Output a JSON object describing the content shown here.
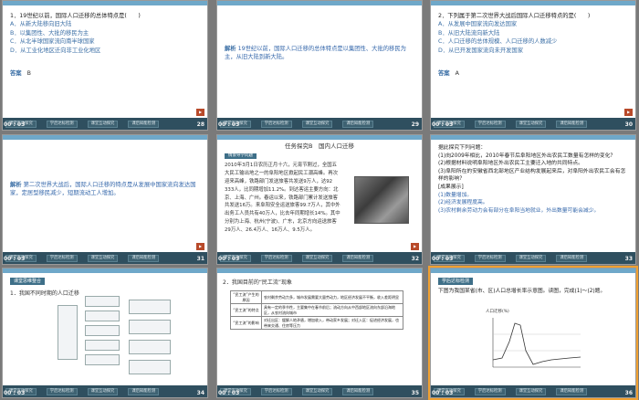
{
  "slides": [
    {
      "page": "28",
      "time": "00 : 03",
      "question": "1．19世纪以前，国际人口迁移的总体特点是(　　)",
      "options": [
        "A．从新大陆移向旧大陆",
        "B．以集团性、大批的移民为主",
        "C．从北半球国家流向南半球国家",
        "D．从工业化地区迁向非工业化地区"
      ],
      "answer_label": "答案",
      "answer": "B"
    },
    {
      "page": "29",
      "time": "00 : 03",
      "analysis_label": "解析",
      "analysis": "19世纪以前，国际人口迁移的总体特点是以集团性、大批的移民为主，从旧大陆到新大陆。"
    },
    {
      "page": "30",
      "time": "00 : 03",
      "question": "2．下列属于第二次世界大战后国际人口迁移特点的是(　　)",
      "options": [
        "A．从发展中国家流向发达国家",
        "B．从旧大陆流向新大陆",
        "C．人口迁移的总体规模、人口迁移的人数减少",
        "D．从已开发国家流向未开发国家"
      ],
      "answer_label": "答案",
      "answer": "A"
    },
    {
      "page": "31",
      "time": "00 : 03",
      "analysis_label": "解析",
      "analysis": "第二次世界大战后，国际人口迁移的特点是从发展中国家流向发达国家，定居型移民减少，短期流动工人增加。"
    },
    {
      "page": "32",
      "time": "00 : 03",
      "title": "任务探究B　国内人口迁移",
      "tag": "情景导学问题",
      "text": "2010年3月1日农历正月十六，元宵节刚过，全国五大民工输出地之一的阜阳地区掀起民工潮高峰。再次迎来高峰，铁路部门发送旅客共发送9万人，达92 333人，比同期增加11.2%。到达客运主要方向：北京、上海、广州。春运以来，铁路部门累计发送旅客共发送16万。来阜阳安全运送旅客99.7万人，其中外出务工人员共有40万人，比去年同期增长14%。其中分别为上海、杭州(宁波)、广东，北京方向运送旅客29万人、26.4万人、16万人、9.5万人。"
    },
    {
      "page": "33",
      "time": "00 : 03",
      "intro": "据此探究下列问题：",
      "items": [
        "(1)向2009年相比，2010年春节后阜阳地区外出农民工数量有怎样的变化？",
        "(2)根据材料说明阜阳地区外出农民工主要迁入地的共同特点。",
        "(3)阜阳所在的安徽省西北部地区产业结构发展起来后，对阜阳外出农民工会有怎样的影响？"
      ],
      "show_label": "[成果展示]",
      "results": [
        "(1)数量增加。",
        "(2)经济发展程度高。",
        "(3)农村剩余劳动力会有部分在阜阳当地就业，外出数量可能会减少。"
      ]
    },
    {
      "page": "34",
      "time": "00 : 03",
      "tag": "课堂思维整合",
      "heading": "1．我国不同时期的人口迁移"
    },
    {
      "page": "35",
      "time": "00 : 03",
      "heading": "2．我国目前的“民工流”现象",
      "rows": [
        {
          "h": "“民工流”产生的原因",
          "c": "农村剩余劳动力多，城市发展需要大量劳动力，地区经济发展不平衡，收入差距明显"
        },
        {
          "h": "“民工流”的特点",
          "c": "具有一定的季节性，主要集中在春节前后；流动方向从中西部地区流向东部沿海地区，从农村流向城市"
        },
        {
          "h": "“民工流”的影响",
          "c": "对迁出区：缓解人地矛盾，增加收入，带动家乡发展；对迁入区：促进经济发展，也带来交通、住房等压力"
        }
      ]
    },
    {
      "page": "36",
      "time": "00 : 03",
      "tag": "学后达标检测",
      "question": "下图为我国某省(市、区)人口总增长率示意图。读图，完成(1)～(2)题。",
      "chart_label": "人口迁移(%)"
    }
  ],
  "footer_buttons": [
    "课堂互动探究",
    "学后达标检测",
    "课堂互动探究",
    "课后知能检测"
  ]
}
